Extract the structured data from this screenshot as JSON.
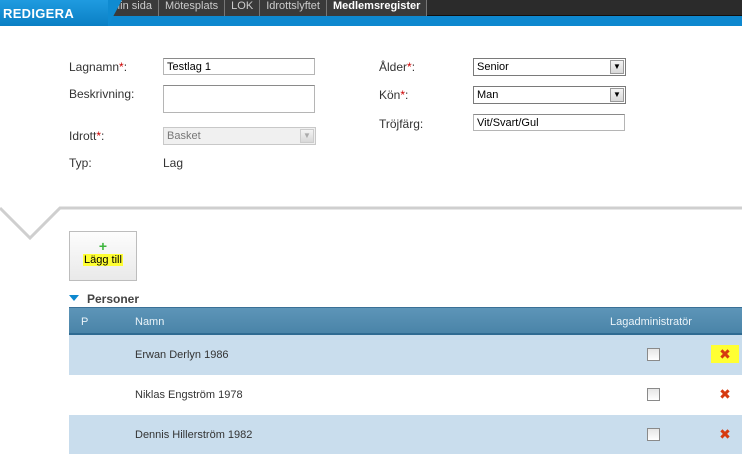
{
  "header": {
    "brand": "REDIGERA",
    "nav": [
      "Min sida",
      "Mötesplats",
      "LOK",
      "Idrottslyftet",
      "Medlemsregister"
    ],
    "active_nav_index": 4
  },
  "form": {
    "lagnamn": {
      "label": "Lagnamn",
      "value": "Testlag 1"
    },
    "beskrivning": {
      "label": "Beskrivning:",
      "value": ""
    },
    "idrott": {
      "label": "Idrott",
      "value": "Basket"
    },
    "typ": {
      "label": "Typ:",
      "value": "Lag"
    },
    "alder": {
      "label": "Ålder",
      "value": "Senior"
    },
    "kon": {
      "label": "Kön",
      "value": "Man"
    },
    "trojfarg": {
      "label": "Tröjfärg:",
      "value": "Vit/Svart/Gul"
    },
    "required_mark": "*",
    "colon": ":"
  },
  "actions": {
    "add_label": "Lägg till",
    "add_icon": "+"
  },
  "persons": {
    "title": "Personer",
    "columns": {
      "p": "P",
      "namn": "Namn",
      "lagadmin": "Lagadministratör"
    },
    "rows": [
      {
        "name": "Erwan Derlyn 1986"
      },
      {
        "name": "Niklas Engström 1978"
      },
      {
        "name": "Dennis Hillerström 1982"
      }
    ],
    "delete_icon": "✖"
  },
  "colors": {
    "accent": "#0e88cf",
    "row_alt": "#c9dded",
    "header": "#4a84a8",
    "highlight": "#ffff33",
    "delete": "#d63a10"
  }
}
